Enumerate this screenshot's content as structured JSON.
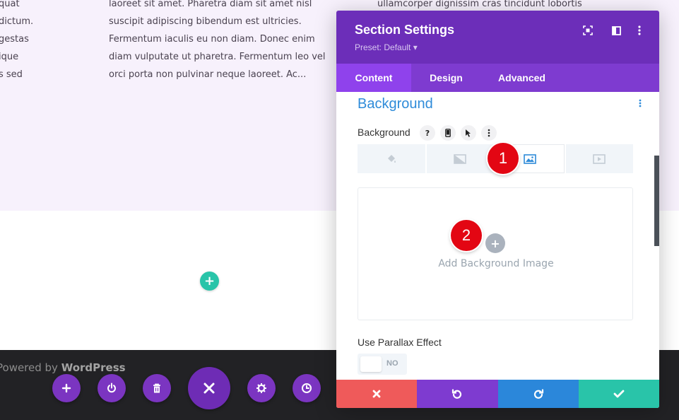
{
  "page": {
    "col1_lines": [
      "quat",
      "dictum.",
      "gestas",
      "ique",
      "s sed"
    ],
    "col2_lines": [
      "laoreet sit amet. Pharetra diam sit amet nisl",
      "suscipit adipiscing bibendum est ultricies.",
      "Fermentum iaculis eu non diam. Donec enim",
      "diam vulputate ut pharetra. Fermentum leo vel",
      "orci porta non pulvinar neque laoreet. Ac..."
    ],
    "col3_lines": [
      "ullamcorper dignissim cras tincidunt lobortis"
    ],
    "add_row_icon": "plus-icon"
  },
  "footer": {
    "prefix": "Powered by ",
    "brand": "WordPress"
  },
  "builder_bar": {
    "buttons": [
      "add-icon",
      "power-icon",
      "trash-icon",
      "close-icon",
      "gear-icon",
      "history-icon"
    ]
  },
  "modal": {
    "title": "Section Settings",
    "preset": "Preset: Default ▾",
    "header_icons": [
      "expand-icon",
      "split-view-icon",
      "more-icon"
    ],
    "tabs": [
      {
        "label": "Content",
        "active": true
      },
      {
        "label": "Design",
        "active": false
      },
      {
        "label": "Advanced",
        "active": false
      }
    ],
    "section_title": "Background",
    "field_label": "Background",
    "field_icons": [
      "?",
      "phone-icon",
      "cursor-icon",
      "more-icon"
    ],
    "bg_types": [
      "color-fill-icon",
      "gradient-icon",
      "image-icon",
      "video-icon"
    ],
    "bg_active_index": 2,
    "upload_text": "Add Background Image",
    "parallax_label": "Use Parallax Effect",
    "parallax_value": "NO",
    "footer_buttons": [
      {
        "name": "discard",
        "color": "#ef5a5a"
      },
      {
        "name": "undo",
        "color": "#7e3bd0"
      },
      {
        "name": "redo",
        "color": "#2b87da"
      },
      {
        "name": "save",
        "color": "#29c4a9"
      }
    ]
  },
  "callouts": [
    "1",
    "2"
  ]
}
